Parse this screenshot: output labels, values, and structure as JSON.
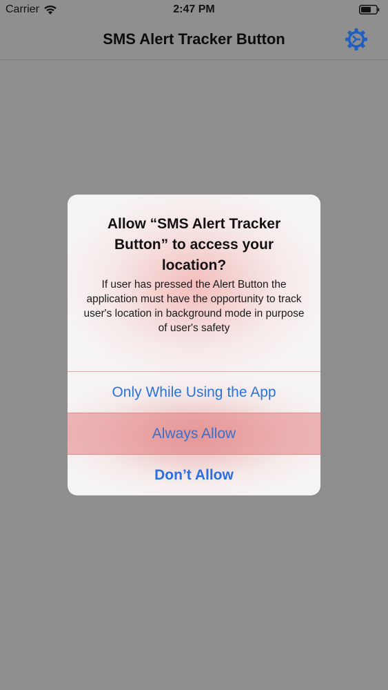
{
  "status_bar": {
    "carrier": "Carrier",
    "time": "2:47 PM"
  },
  "nav": {
    "title": "SMS Alert Tracker Button"
  },
  "alert": {
    "title": "Allow “SMS Alert Tracker Button” to access your location?",
    "message": "If user has pressed the Alert Button the application must have the opportunity to track user's location in background mode in purpose of user's safety",
    "actions": [
      {
        "label": "Only While Using the App"
      },
      {
        "label": "Always Allow"
      },
      {
        "label": "Don’t Allow"
      }
    ]
  },
  "colors": {
    "accent": "#2a73d8",
    "dim_background": "#8e8e8e"
  }
}
